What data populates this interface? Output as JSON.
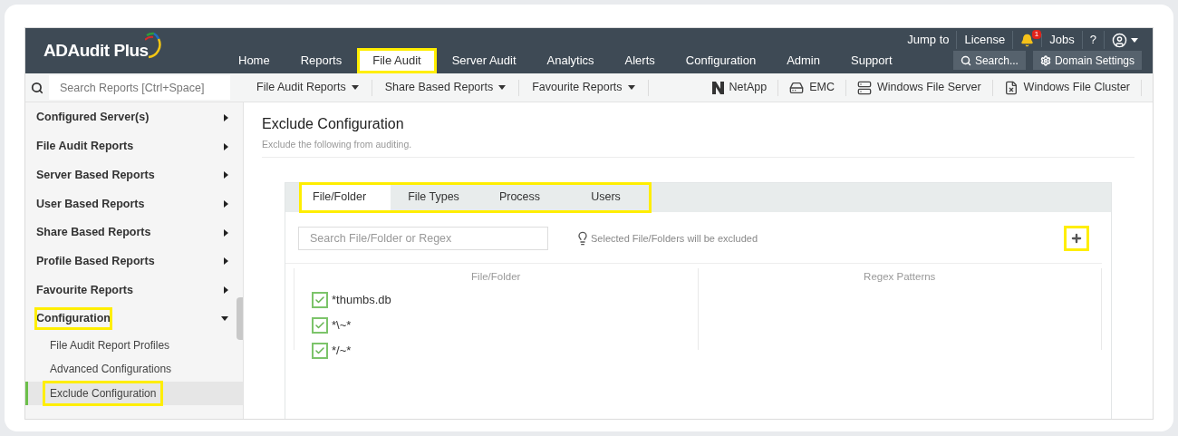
{
  "brand": {
    "name": "ADAudit Plus"
  },
  "top_links": [
    {
      "kind": "link",
      "label": "Jump to"
    },
    {
      "kind": "link",
      "label": "License"
    },
    {
      "kind": "bell",
      "badge": "1"
    },
    {
      "kind": "link",
      "label": "Jobs"
    },
    {
      "kind": "link",
      "label": "?"
    },
    {
      "kind": "account"
    }
  ],
  "nav_tabs": [
    {
      "label": "Home",
      "selected": false,
      "highlighted": false
    },
    {
      "label": "Reports",
      "selected": false,
      "highlighted": false
    },
    {
      "label": "File Audit",
      "selected": true,
      "highlighted": true
    },
    {
      "label": "Server Audit",
      "selected": false,
      "highlighted": false
    },
    {
      "label": "Analytics",
      "selected": false,
      "highlighted": false
    },
    {
      "label": "Alerts",
      "selected": false,
      "highlighted": false
    },
    {
      "label": "Configuration",
      "selected": false,
      "highlighted": false
    },
    {
      "label": "Admin",
      "selected": false,
      "highlighted": false
    },
    {
      "label": "Support",
      "selected": false,
      "highlighted": false
    }
  ],
  "header_buttons": [
    {
      "kind": "search",
      "label": "Search..."
    },
    {
      "kind": "settings",
      "label": "Domain Settings"
    }
  ],
  "search": {
    "placeholder": "Search Reports [Ctrl+Space]"
  },
  "report_menus": [
    "File Audit Reports",
    "Share Based Reports",
    "Favourite Reports"
  ],
  "storage_links": [
    {
      "kind": "netapp",
      "label": "NetApp"
    },
    {
      "kind": "emc",
      "label": "EMC"
    },
    {
      "kind": "server",
      "label": "Windows File Server"
    },
    {
      "kind": "cluster",
      "label": "Windows File Cluster"
    }
  ],
  "sidebar": {
    "items": [
      {
        "label": "Configured Server(s)",
        "expanded": false,
        "highlighted": false
      },
      {
        "label": "File Audit Reports",
        "expanded": false,
        "highlighted": false
      },
      {
        "label": "Server Based Reports",
        "expanded": false,
        "highlighted": false
      },
      {
        "label": "User Based Reports",
        "expanded": false,
        "highlighted": false
      },
      {
        "label": "Share Based Reports",
        "expanded": false,
        "highlighted": false
      },
      {
        "label": "Profile Based Reports",
        "expanded": false,
        "highlighted": false
      },
      {
        "label": "Favourite Reports",
        "expanded": false,
        "highlighted": false
      },
      {
        "label": "Configuration",
        "expanded": true,
        "highlighted": true,
        "children": [
          {
            "label": "File Audit Report Profiles",
            "selected": false,
            "highlighted": false
          },
          {
            "label": "Advanced Configurations",
            "selected": false,
            "highlighted": false
          },
          {
            "label": "Exclude Configuration",
            "selected": true,
            "highlighted": true
          }
        ]
      }
    ]
  },
  "page": {
    "title": "Exclude Configuration",
    "subtitle": "Exclude the following from auditing."
  },
  "exclude_tabs": {
    "highlighted": true,
    "items": [
      {
        "label": "File/Folder",
        "selected": true
      },
      {
        "label": "File Types",
        "selected": false
      },
      {
        "label": "Process",
        "selected": false
      },
      {
        "label": "Users",
        "selected": false
      }
    ]
  },
  "filter": {
    "placeholder": "Search File/Folder or Regex"
  },
  "hint": "Selected File/Folders will be excluded",
  "add_button": {
    "highlighted": true
  },
  "columns": [
    "File/Folder",
    "Regex Patterns"
  ],
  "entries": [
    {
      "label": "*thumbs.db",
      "checked": true
    },
    {
      "label": "*\\~*",
      "checked": true
    },
    {
      "label": "*/~*",
      "checked": true
    }
  ]
}
